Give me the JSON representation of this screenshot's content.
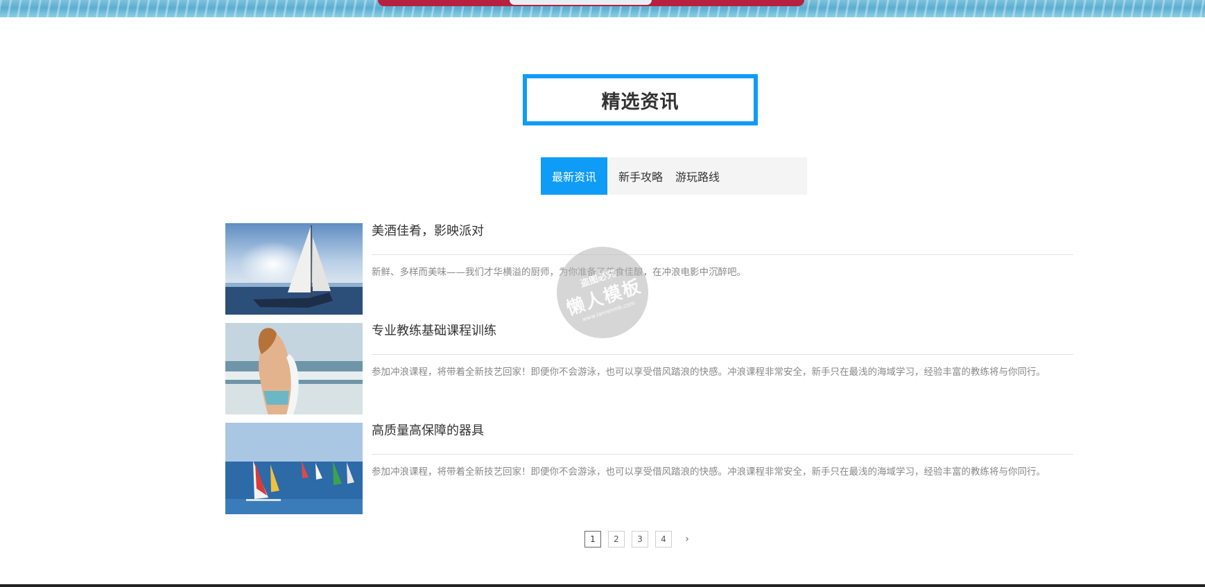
{
  "section": {
    "title": "精选资讯"
  },
  "tabs": [
    {
      "label": "最新资讯",
      "active": true
    },
    {
      "label": "新手攻略",
      "active": false
    },
    {
      "label": "游玩路线",
      "active": false
    }
  ],
  "news": [
    {
      "title": "美酒佳肴，影映派对",
      "desc": "新鲜、多样而美味——我们才华横溢的厨师，为你准备了美食佳酿，在冲浪电影中沉醉吧。",
      "image": "sailboat-photo"
    },
    {
      "title": "专业教练基础课程训练",
      "desc": "参加冲浪课程，将带着全新技艺回家！即便你不会游泳，也可以享受借风踏浪的快感。冲浪课程非常安全，新手只在最浅的海域学习，经验丰富的教练将与你同行。",
      "image": "surfer-woman-photo"
    },
    {
      "title": "高质量高保障的器具",
      "desc": "参加冲浪课程，将带着全新技艺回家！即便你不会游泳，也可以享受借风踏浪的快感。冲浪课程非常安全，新手只在最浅的海域学习，经验丰富的教练将与你同行。",
      "image": "windsurfers-photo"
    }
  ],
  "pagination": {
    "pages": [
      "1",
      "2",
      "3",
      "4"
    ],
    "current": "1",
    "next": "›"
  },
  "watermark": {
    "line1": "盗图必究",
    "line2": "懒人模板",
    "url": "www.lanrenmb.com"
  },
  "colors": {
    "accent": "#0e9cf6"
  }
}
